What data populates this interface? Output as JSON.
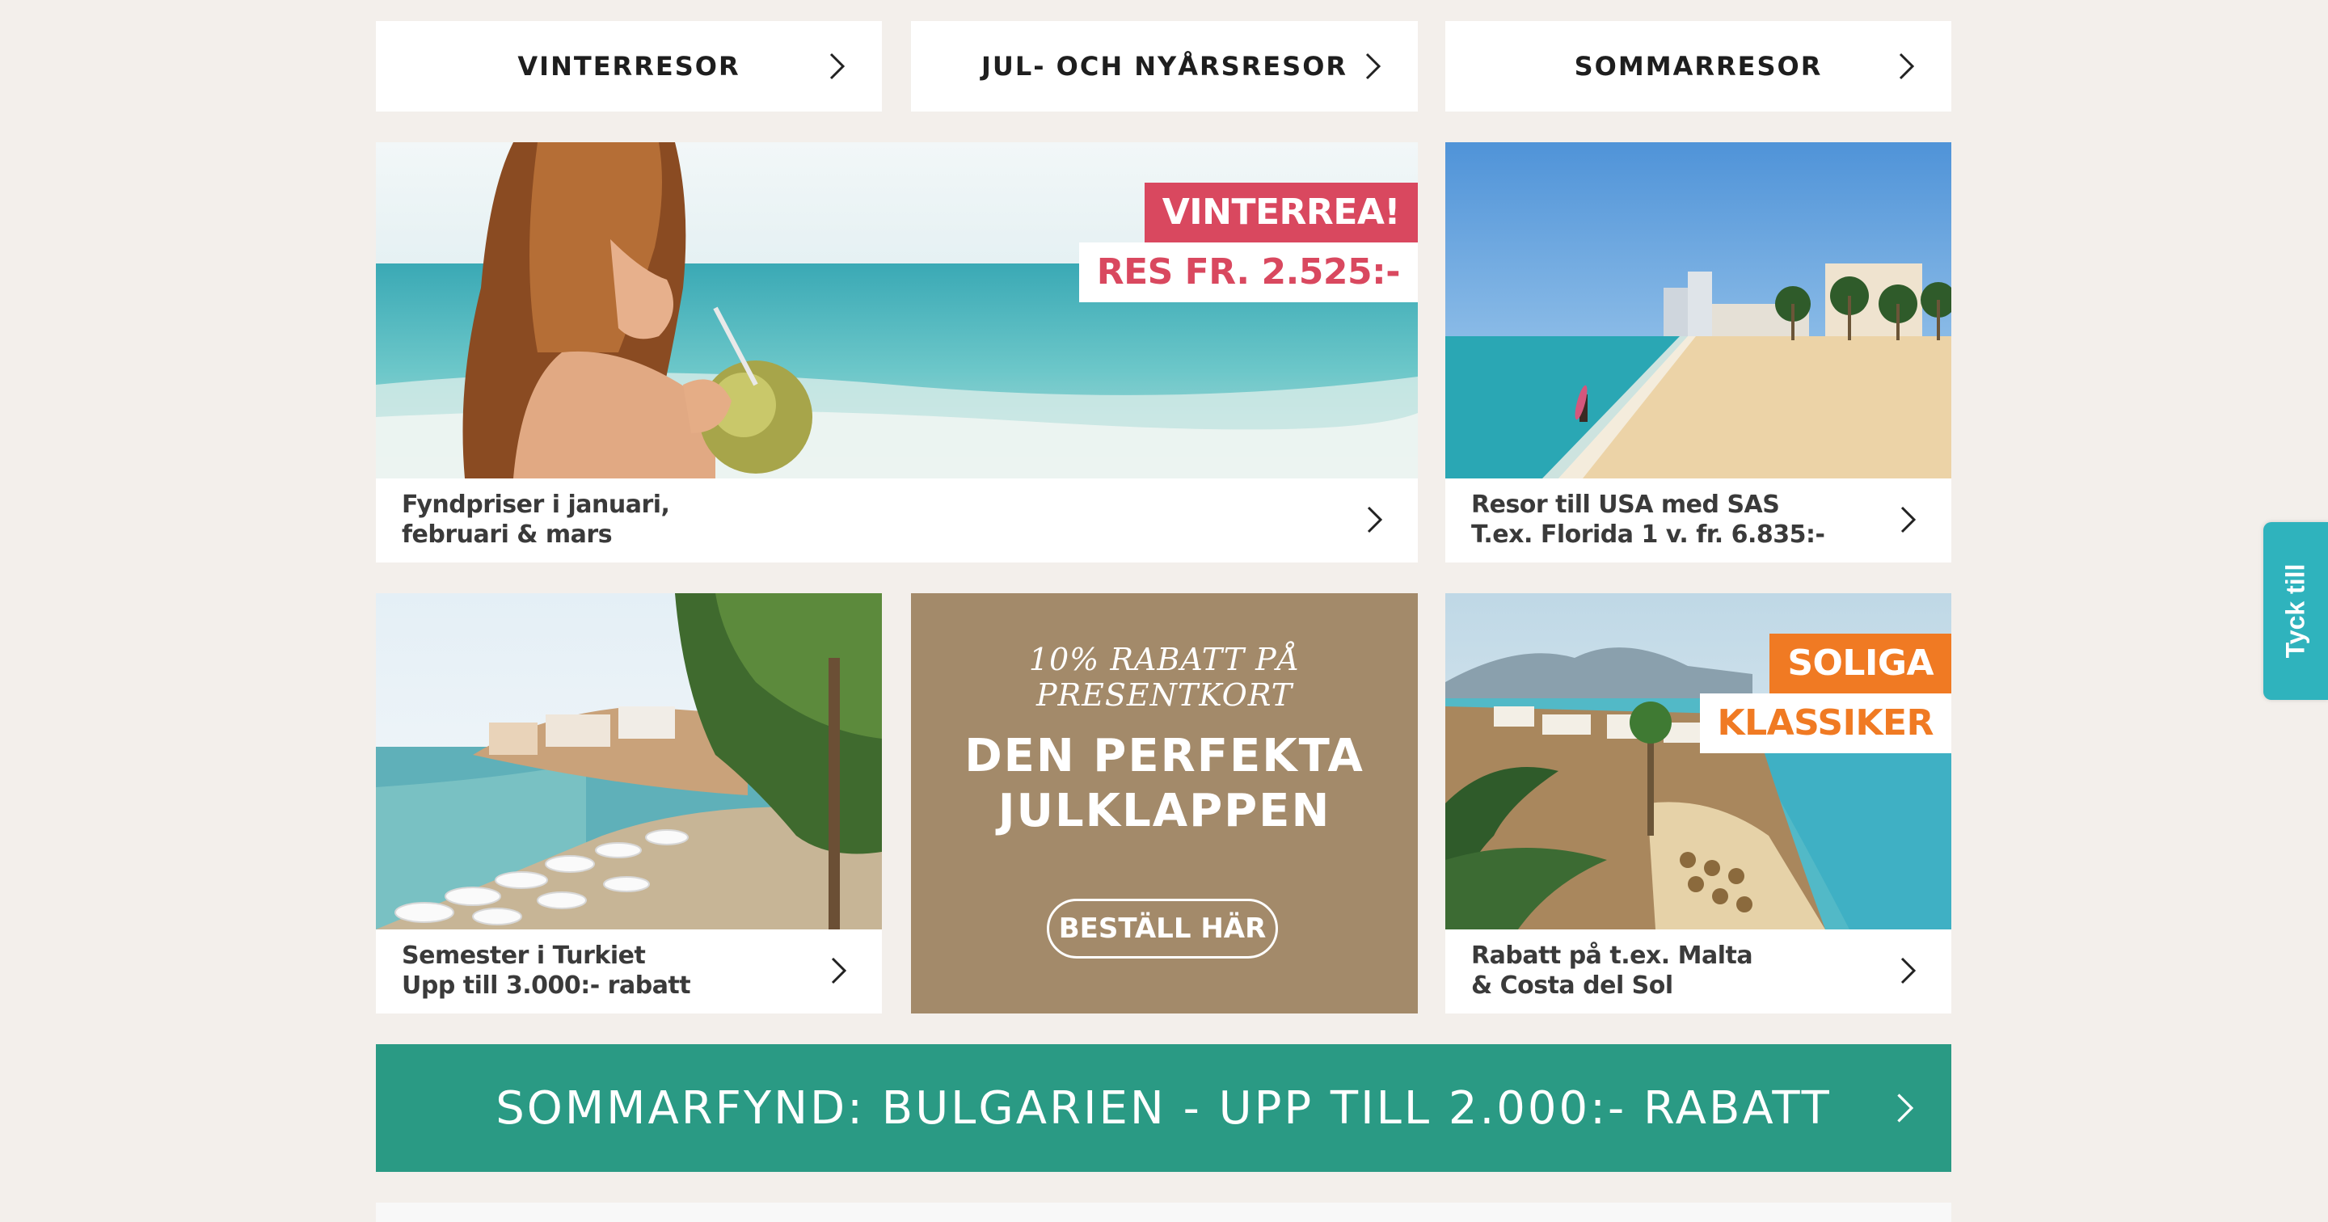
{
  "nav": [
    {
      "label": "VINTERRESOR"
    },
    {
      "label": "JUL- OCH NYÅRSRESOR"
    },
    {
      "label": "SOMMARRESOR"
    }
  ],
  "cards": {
    "vinterrea": {
      "badge_top": "VINTERREA!",
      "badge_bottom": "RES FR. 2.525:-",
      "caption_line1": "Fyndpriser i januari,",
      "caption_line2": "februari & mars"
    },
    "usa": {
      "caption_line1": "Resor till USA med SAS",
      "caption_line2": "T.ex. Florida 1 v. fr. 6.835:-"
    },
    "turkiet": {
      "caption_line1": "Semester i Turkiet",
      "caption_line2": "Upp till 3.000:- rabatt"
    },
    "soliga": {
      "badge_top": "SOLIGA",
      "badge_bottom": "KLASSIKER",
      "caption_line1": "Rabatt på t.ex. Malta",
      "caption_line2": "& Costa del Sol"
    }
  },
  "promo": {
    "kicker": "10% RABATT PÅ PRESENTKORT",
    "headline_line1": "DEN PERFEKTA",
    "headline_line2": "JULKLAPPEN",
    "cta": "BESTÄLL HÄR"
  },
  "banner": {
    "label": "SOMMARFYND: BULGARIEN - UPP TILL 2.000:- RABATT"
  },
  "feedback": {
    "label": "Tyck till"
  },
  "colors": {
    "background": "#f3efeb",
    "badge_red": "#d9485f",
    "badge_orange": "#f07a23",
    "promo_brown": "#a38a6a",
    "banner_green": "#2a9a84",
    "feedback_teal": "#2fb3bd"
  }
}
